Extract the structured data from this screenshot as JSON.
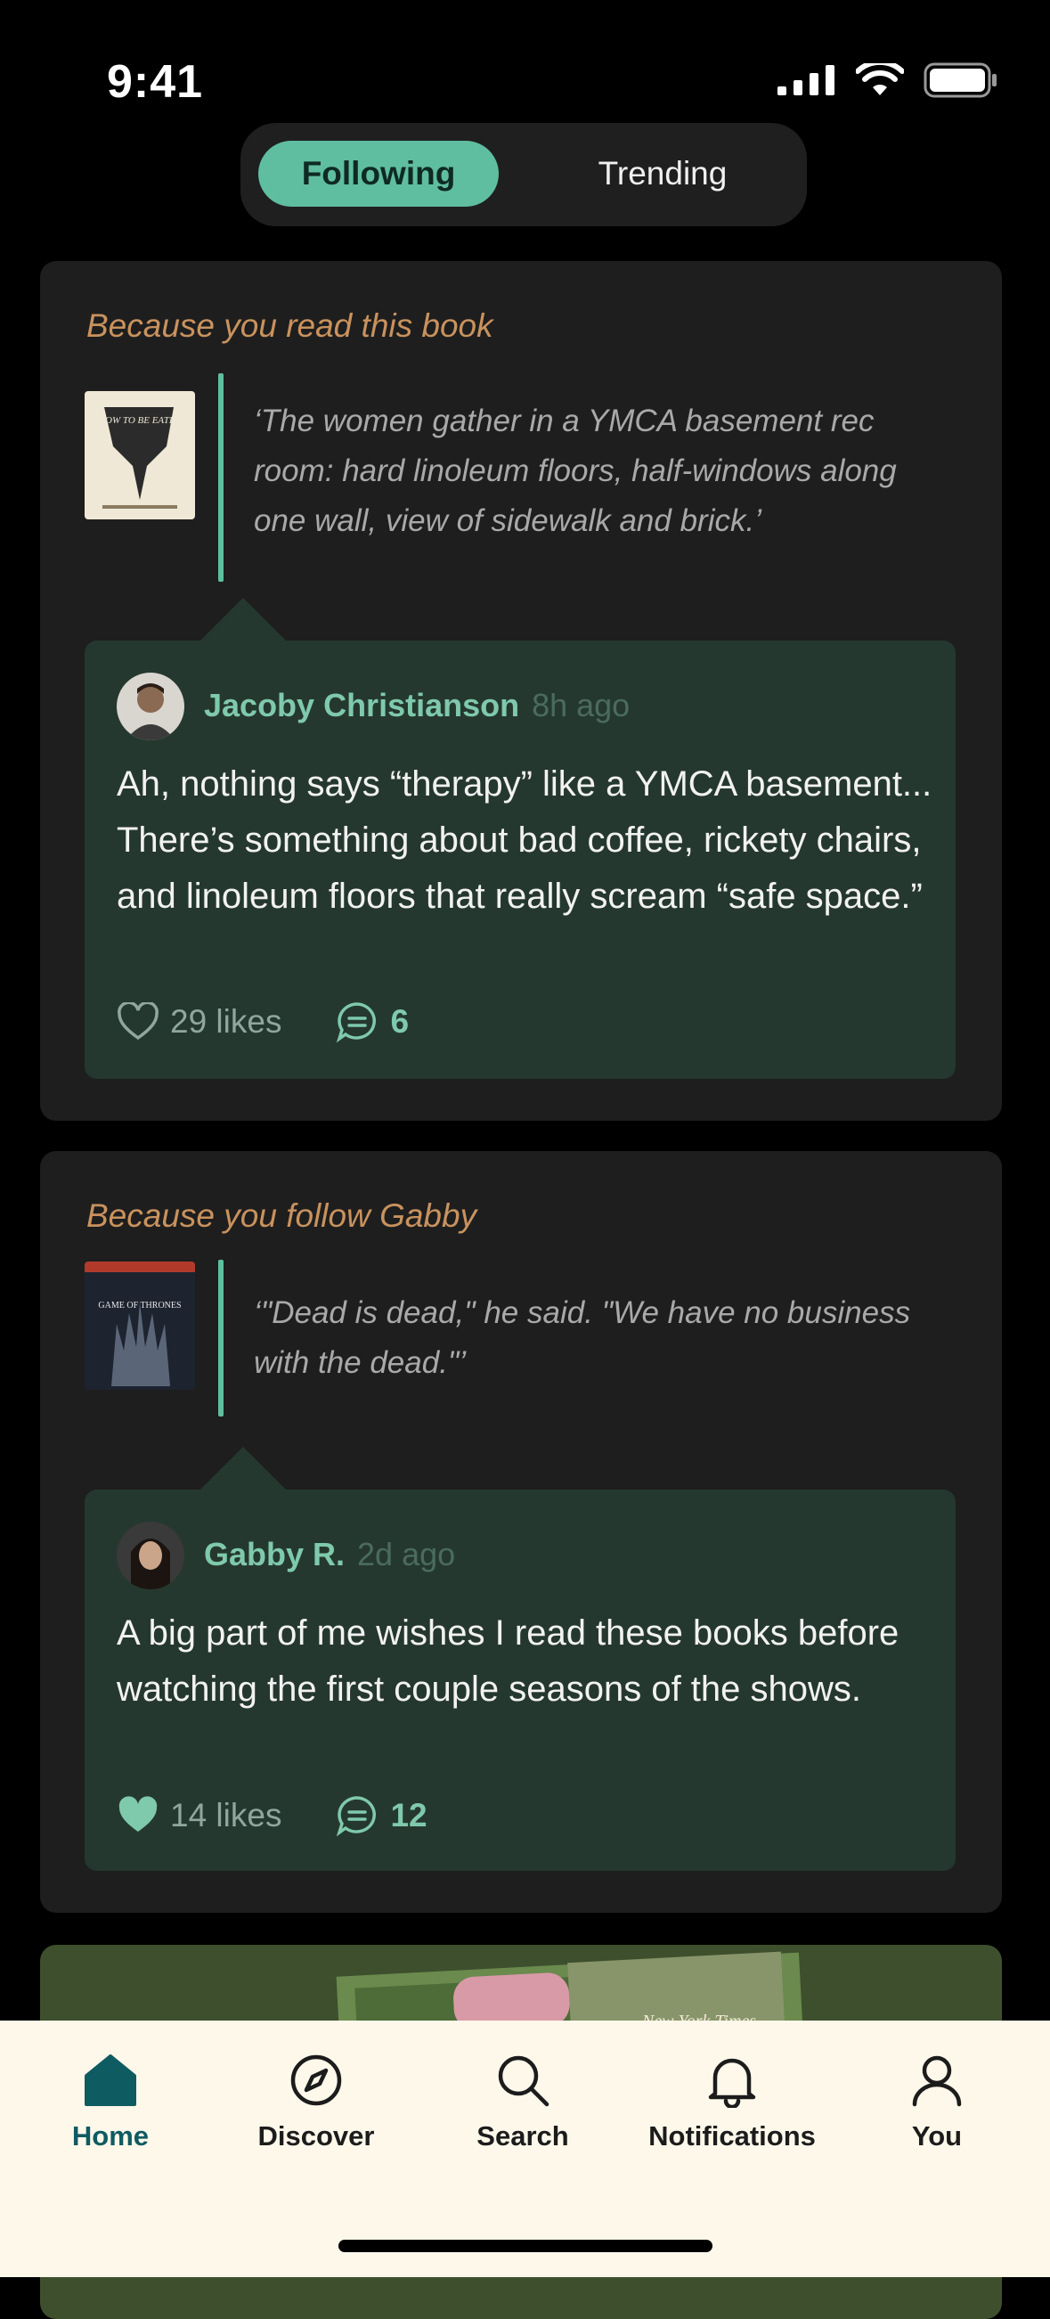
{
  "status_bar": {
    "time": "9:41"
  },
  "segmented": {
    "following": "Following",
    "trending": "Trending"
  },
  "feed": {
    "card1": {
      "reason": "Because you read this book",
      "book_title_cover": "HOW TO BE EATEN",
      "quote": "‘The women gather in a YMCA basement rec room: hard linoleum floors, half-windows along one wall, view of sidewalk and brick.’",
      "comment": {
        "author": "Jacoby Christianson",
        "ago": "8h ago",
        "text": "Ah, nothing says “therapy” like a YMCA basement... There’s something about bad coffee, rickety chairs, and linoleum floors that really scream “safe space.”",
        "likes": "29 likes",
        "replies": "6"
      }
    },
    "card2": {
      "reason": "Because you follow Gabby",
      "book_title_cover": "GAME OF THRONES",
      "quote": "‘\"Dead is dead,\" he said. \"We have no business with the dead.\"’",
      "comment": {
        "author": "Gabby R.",
        "ago": "2d ago",
        "text": "A big part of me wishes I read these books before watching the first couple seasons of the shows.",
        "likes": "14 likes",
        "replies": "12"
      }
    },
    "card3": {
      "cover_text": "New York Times"
    }
  },
  "tabbar": {
    "home": "Home",
    "discover": "Discover",
    "search": "Search",
    "notifications": "Notifications",
    "you": "You"
  },
  "colors": {
    "accent": "#5fbea0",
    "reason": "#c9925e",
    "comment_bg": "#25382f",
    "tab_active": "#0f5b62"
  }
}
